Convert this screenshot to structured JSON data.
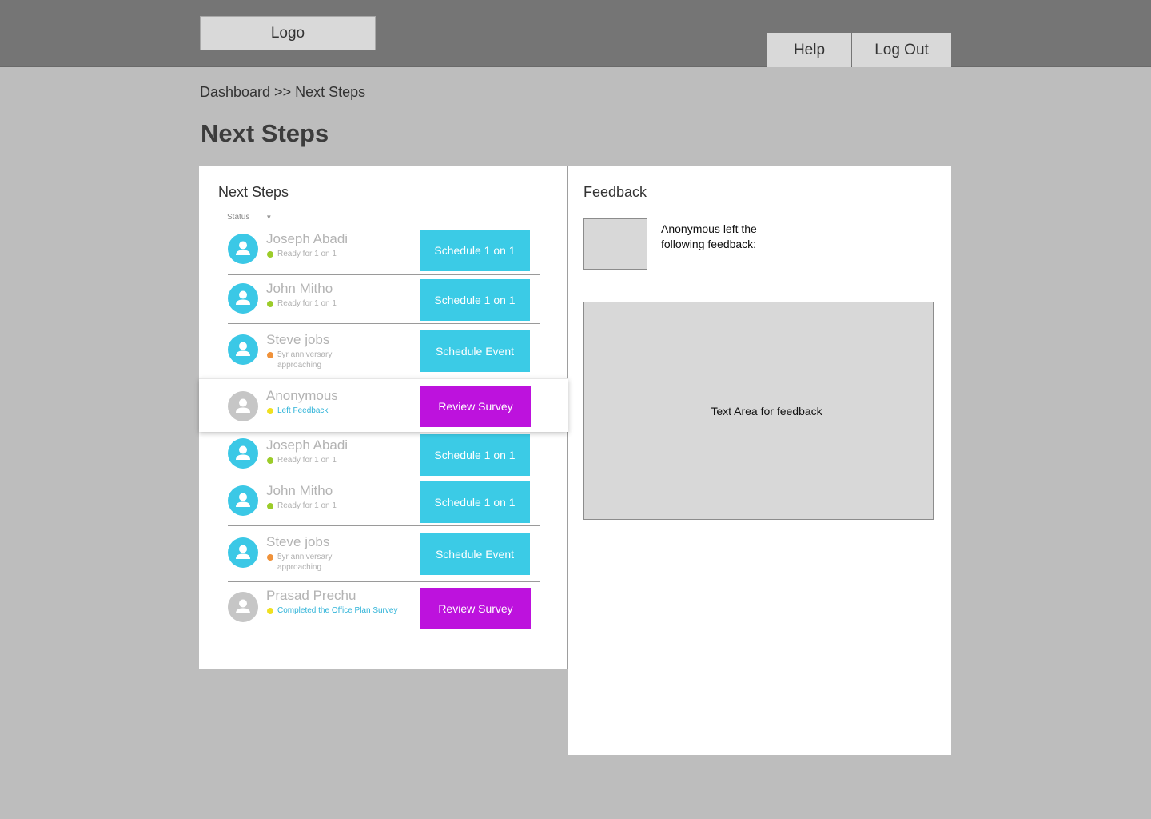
{
  "header": {
    "logo": "Logo",
    "help": "Help",
    "logout": "Log Out"
  },
  "breadcrumb": "Dashboard >> Next Steps",
  "page_title": "Next Steps",
  "next_steps": {
    "heading": "Next Steps",
    "filter_label": "Status",
    "rows": [
      {
        "name": "Joseph Abadi",
        "status": "Ready for 1 on 1",
        "status_color": "#9ccc2a",
        "action": "Schedule 1 on 1",
        "action_color": "#3bcbe6"
      },
      {
        "name": "John Mitho",
        "status": "Ready for 1 on 1",
        "status_color": "#9ccc2a",
        "action": "Schedule 1 on 1",
        "action_color": "#3bcbe6"
      },
      {
        "name": "Steve jobs",
        "status": "5yr anniversary approaching",
        "status_color": "#f0923a",
        "action": "Schedule Event",
        "action_color": "#3bcbe6"
      },
      {
        "name": "Anonymous",
        "status": "Left Feedback",
        "status_color": "#f0e020",
        "action": "Review Survey",
        "action_color": "#bd12dd",
        "highlighted": true
      },
      {
        "name": "Joseph Abadi",
        "status": "Ready for 1 on 1",
        "status_color": "#9ccc2a",
        "action": "Schedule 1 on 1",
        "action_color": "#3bcbe6"
      },
      {
        "name": "John Mitho",
        "status": "Ready for 1 on 1",
        "status_color": "#9ccc2a",
        "action": "Schedule 1 on 1",
        "action_color": "#3bcbe6"
      },
      {
        "name": "Steve jobs",
        "status": "5yr anniversary approaching",
        "status_color": "#f0923a",
        "action": "Schedule Event",
        "action_color": "#3bcbe6"
      },
      {
        "name": "Prasad Prechu",
        "status": "Completed the Office Plan Survey",
        "status_color": "#f0e020",
        "action": "Review Survey",
        "action_color": "#bd12dd"
      }
    ]
  },
  "feedback": {
    "heading": "Feedback",
    "intro": "Anonymous left the following feedback:",
    "textarea_label": "Text Area for feedback"
  },
  "icons": {
    "avatar": "user-avatar-icon",
    "caret": "caret-down-icon"
  }
}
